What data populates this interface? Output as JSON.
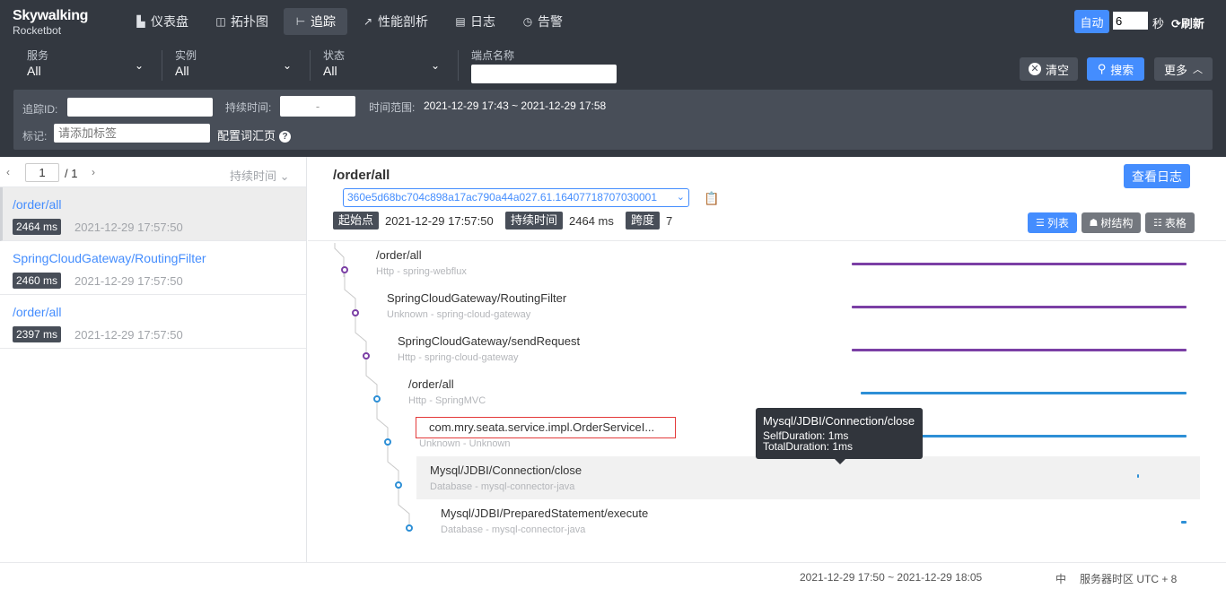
{
  "brand": {
    "name": "Skywalking",
    "sub": "Rocketbot"
  },
  "nav": [
    {
      "icon": "dashboard-icon",
      "glyph": "▙",
      "label": "仪表盘"
    },
    {
      "icon": "topology-icon",
      "glyph": "◫",
      "label": "拓扑图"
    },
    {
      "icon": "trace-icon",
      "glyph": "⊢",
      "label": "追踪"
    },
    {
      "icon": "profile-icon",
      "glyph": "↗",
      "label": "性能剖析"
    },
    {
      "icon": "log-icon",
      "glyph": "▤",
      "label": "日志"
    },
    {
      "icon": "alarm-icon",
      "glyph": "◷",
      "label": "告警"
    }
  ],
  "refresh": {
    "auto_label": "自动",
    "interval": "6",
    "sec_label": "秒",
    "refresh_label": "⟳刷新"
  },
  "filters": {
    "service": {
      "label": "服务",
      "value": "All"
    },
    "instance": {
      "label": "实例",
      "value": "All"
    },
    "status": {
      "label": "状态",
      "value": "All"
    },
    "endpoint": {
      "label": "端点名称",
      "value": ""
    },
    "clear_label": "清空",
    "search_label": "搜索",
    "more_label": "更多"
  },
  "advanced": {
    "trace_id_label": "追踪ID:",
    "trace_id_value": "",
    "duration_label": "持续时间:",
    "duration_value": "-",
    "time_range_label": "时间范围:",
    "time_range_value": "2021-12-29 17:43 ~ 2021-12-29 17:58",
    "tags_label": "标记:",
    "tags_placeholder": "请添加标签",
    "config_label": "配置词汇页"
  },
  "pager": {
    "current": "1",
    "total": "/ 1",
    "sort_label": "持续时间"
  },
  "traces": [
    {
      "name": "/order/all",
      "duration": "2464 ms",
      "time": "2021-12-29 17:57:50"
    },
    {
      "name": "SpringCloudGateway/RoutingFilter",
      "duration": "2460 ms",
      "time": "2021-12-29 17:57:50"
    },
    {
      "name": "/order/all",
      "duration": "2397 ms",
      "time": "2021-12-29 17:57:50"
    }
  ],
  "detail": {
    "title": "/order/all",
    "trace_id": "360e5d68bc704c898a17ac790a44a027.61.16407718707030001",
    "start_label": "起始点",
    "start_value": "2021-12-29 17:57:50",
    "duration_label": "持续时间",
    "duration_value": "2464 ms",
    "span_label": "跨度",
    "span_value": "7",
    "view_logs_label": "查看日志",
    "views": {
      "list": "列表",
      "tree": "树结构",
      "table": "表格"
    }
  },
  "spans": [
    {
      "name": "/order/all",
      "sub": "Http - spring-webflux",
      "color": "#7b3fa5",
      "start": 0.0,
      "end": 1.0
    },
    {
      "name": "SpringCloudGateway/RoutingFilter",
      "sub": "Unknown - spring-cloud-gateway",
      "color": "#7b3fa5",
      "start": 0.0,
      "end": 1.0
    },
    {
      "name": "SpringCloudGateway/sendRequest",
      "sub": "Http - spring-cloud-gateway",
      "color": "#7b3fa5",
      "start": 0.0,
      "end": 1.0
    },
    {
      "name": "/order/all",
      "sub": "Http - SpringMVC",
      "color": "#2d8fd6",
      "start": 0.027,
      "end": 1.0
    },
    {
      "name": "com.mry.seata.service.impl.OrderServiceI...",
      "sub": "Unknown - Unknown",
      "color": "#2d8fd6",
      "start": 0.0,
      "end": 1.0
    },
    {
      "name": "Mysql/JDBI/Connection/close",
      "sub": "Database - mysql-connector-java",
      "color": "#2d8fd6",
      "start": 0.853,
      "end": 0.856
    },
    {
      "name": "Mysql/JDBI/PreparedStatement/execute",
      "sub": "Database - mysql-connector-java",
      "color": "#2d8fd6",
      "start": 0.985,
      "end": 1.0
    }
  ],
  "tooltip": {
    "title": "Mysql/JDBI/Connection/close",
    "self": "SelfDuration: 1ms",
    "total": "TotalDuration: 1ms"
  },
  "footer": {
    "time_range": "2021-12-29 17:50 ~ 2021-12-29 18:05",
    "lang": "中",
    "timezone": "服务器时区 UTC + 8"
  }
}
